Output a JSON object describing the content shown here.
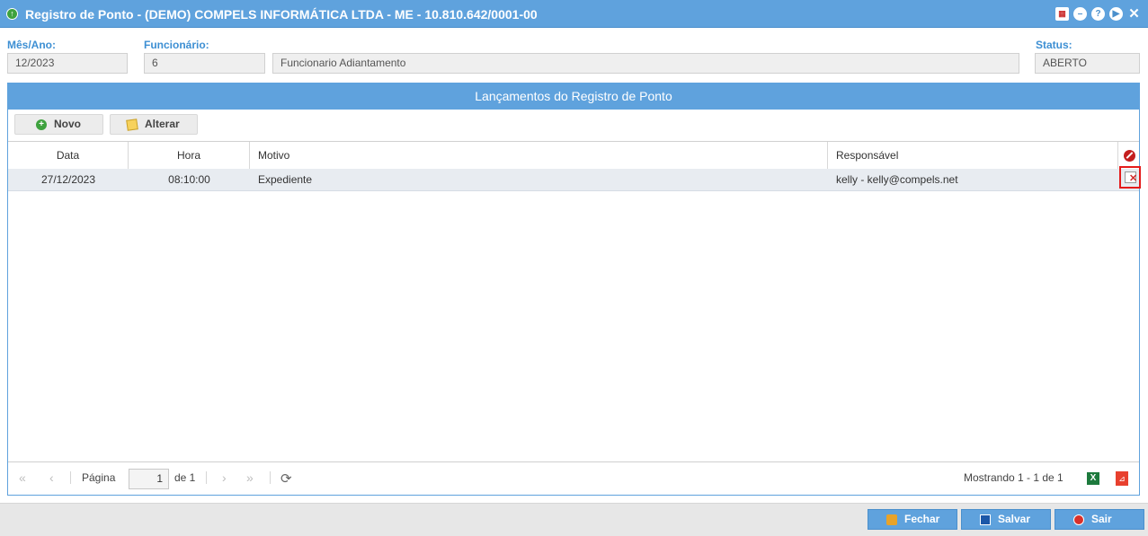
{
  "window": {
    "title": "Registro de Ponto - (DEMO) COMPELS INFORMÁTICA LTDA - ME - 10.810.642/0001-00"
  },
  "form": {
    "mes_ano_label": "Mês/Ano:",
    "mes_ano_value": "12/2023",
    "funcionario_label": "Funcionário:",
    "funcionario_id": "6",
    "funcionario_nome": "Funcionario Adiantamento",
    "status_label": "Status:",
    "status_value": "ABERTO"
  },
  "panel": {
    "title": "Lançamentos do Registro de Ponto",
    "toolbar": {
      "novo_label": "Novo",
      "alterar_label": "Alterar"
    }
  },
  "grid": {
    "columns": [
      "Data",
      "Hora",
      "Motivo",
      "Responsável"
    ],
    "rows": [
      {
        "data": "27/12/2023",
        "hora": "08:10:00",
        "motivo": "Expediente",
        "responsavel": "kelly - kelly@compels.net"
      }
    ]
  },
  "pager": {
    "page_label": "Página",
    "page_value": "1",
    "page_total": "de 1",
    "showing": "Mostrando 1 - 1 de 1"
  },
  "footer": {
    "fechar_label": "Fechar",
    "salvar_label": "Salvar",
    "sair_label": "Sair"
  }
}
